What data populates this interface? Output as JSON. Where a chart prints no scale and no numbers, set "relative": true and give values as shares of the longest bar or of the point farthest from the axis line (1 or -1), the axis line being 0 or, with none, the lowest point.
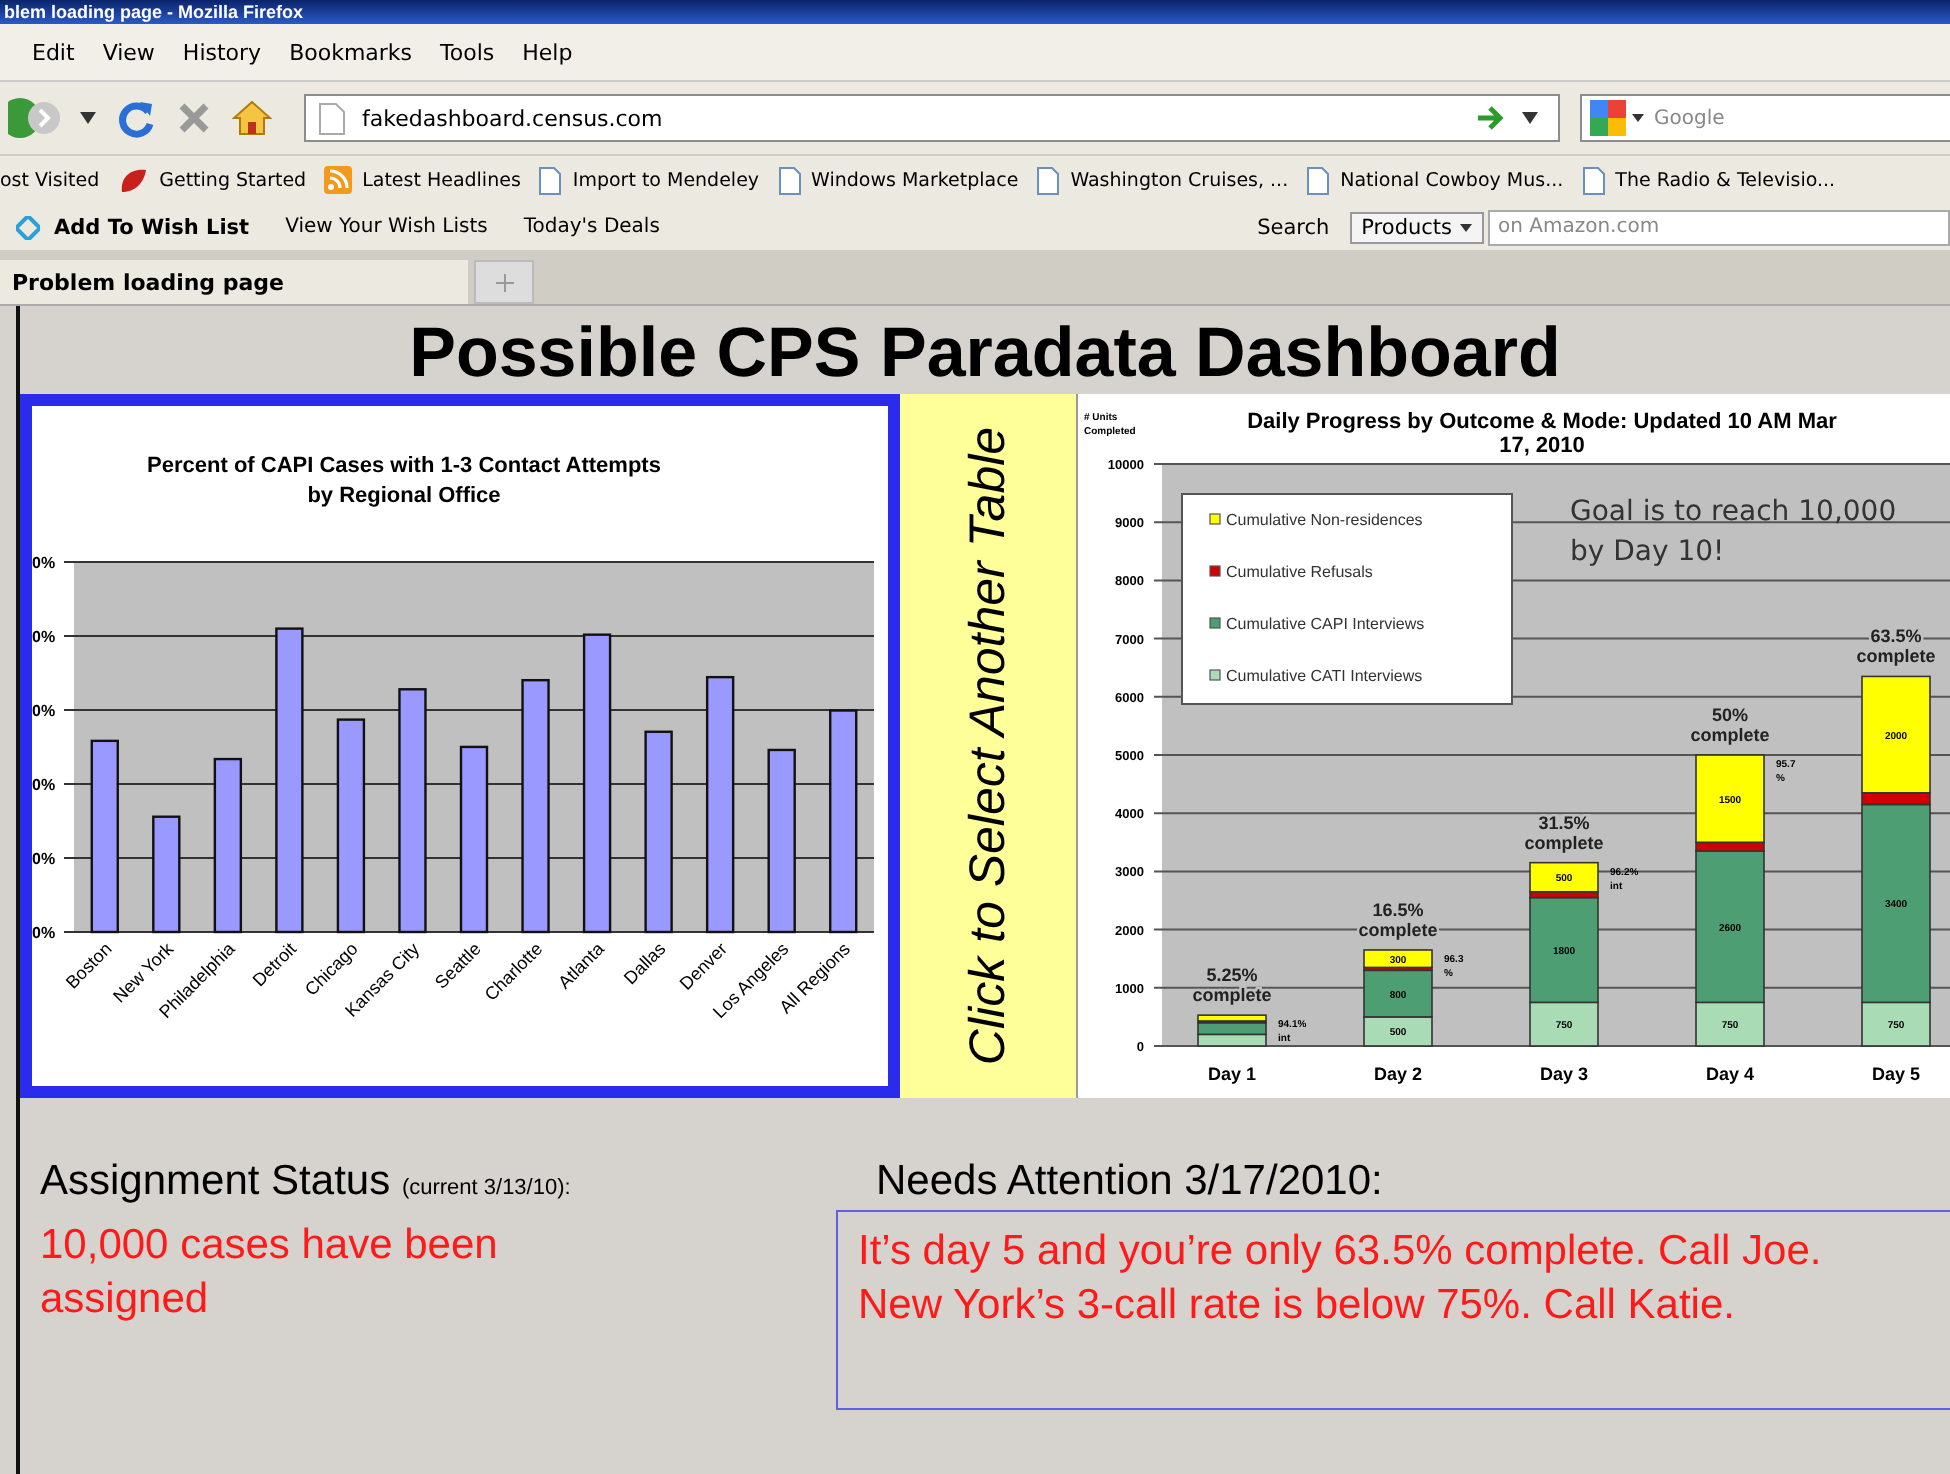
{
  "browser": {
    "title": "blem loading page - Mozilla Firefox",
    "menu": [
      "Edit",
      "View",
      "History",
      "Bookmarks",
      "Tools",
      "Help"
    ],
    "address": "fakedashboard.census.com",
    "search": {
      "placeholder": "Google"
    },
    "bookmarks": [
      {
        "label": "ost Visited",
        "kind": "plain"
      },
      {
        "label": "Getting Started",
        "kind": "starter"
      },
      {
        "label": "Latest Headlines",
        "kind": "feed"
      },
      {
        "label": "Import to Mendeley",
        "kind": "page"
      },
      {
        "label": "Windows Marketplace",
        "kind": "page"
      },
      {
        "label": "Washington Cruises, ...",
        "kind": "page"
      },
      {
        "label": "National Cowboy Mus...",
        "kind": "page"
      },
      {
        "label": "The Radio & Televisio...",
        "kind": "page"
      }
    ],
    "amazon_toolbar": {
      "wish_list": "Add To Wish List",
      "links": [
        "View Your Wish Lists",
        "Today's Deals"
      ],
      "search_label": "Search",
      "category": "Products",
      "placeholder": "on Amazon.com"
    },
    "tabs": [
      {
        "label": "Problem loading page",
        "selected": true
      }
    ]
  },
  "dashboard": {
    "title": "Possible CPS Paradata Dashboard",
    "left_chart": {
      "chart_data": {
        "type": "bar",
        "title": "Percent of CAPI Cases with 1-3 Contact Attempts\nby Regional Office",
        "categories": [
          "Boston",
          "New York",
          "Philadelphia",
          "Detroit",
          "Chicago",
          "Kansas City",
          "Seattle",
          "Charlotte",
          "Atlanta",
          "Dallas",
          "Denver",
          "Los Angeles",
          "All Regions"
        ],
        "values": [
          0.63,
          0.38,
          0.57,
          1,
          0.7,
          0.8,
          0.61,
          0.83,
          0.98,
          0.66,
          0.84,
          0.6,
          0.73
        ],
        "relative": true
      },
      "tick_labels": [
        "0%",
        "0%",
        "0%",
        "0%",
        "0%",
        "0%"
      ]
    },
    "select_table": "Click to Select Another Table",
    "right_chart": {
      "chart_data": {
        "type": "bar",
        "stacked": true,
        "title": "Daily Progress by Outcome & Mode: Updated 10 AM Mar\n17, 2010",
        "ylabel": "# Units\nCompleted",
        "categories": [
          "Day 1",
          "Day 2",
          "Day 3",
          "Day 4",
          "Day 5"
        ],
        "series": [
          {
            "name": "Cumulative CATI Interviews",
            "color": "#a9dcb4",
            "values": [
              200,
              500,
              750,
              750,
              750
            ],
            "value_labels": [
              null,
              "500",
              "750",
              "750",
              "750"
            ]
          },
          {
            "name": "Cumulative CAPI Interviews",
            "color": "#4e9e74",
            "values": [
              200,
              800,
              1800,
              2600,
              3400
            ],
            "value_labels": [
              null,
              "800",
              "1800",
              "2600",
              "3400"
            ]
          },
          {
            "name": "Cumulative Refusals",
            "color": "#d40000",
            "values": [
              30,
              50,
              100,
              150,
              200
            ],
            "value_labels": [
              null,
              null,
              null,
              null,
              null
            ]
          },
          {
            "name": "Cumulative Non-residences",
            "color": "#ffff00",
            "values": [
              100,
              300,
              500,
              1500,
              2000
            ],
            "value_labels": [
              null,
              "300",
              "500",
              "1500",
              "2000"
            ]
          }
        ],
        "ylim": [
          0,
          10000
        ],
        "yticks": [
          0,
          1000,
          2000,
          3000,
          4000,
          5000,
          6000,
          7000,
          8000,
          9000,
          10000
        ],
        "grid": true,
        "legend": "upper left"
      },
      "goal_note": [
        "Goal is to reach 10,000",
        "by Day 10!"
      ],
      "complete_labels": [
        [
          "5.25%",
          "complete"
        ],
        [
          "16.5%",
          "complete"
        ],
        [
          "31.5%",
          "complete"
        ],
        [
          "50%",
          "complete"
        ],
        [
          "63.5%",
          "complete"
        ]
      ],
      "rate_labels": [
        [
          "94.1%",
          "int"
        ],
        [
          "96.3",
          "%"
        ],
        [
          "96.2%",
          "int"
        ],
        [
          "95.7",
          "%"
        ]
      ]
    },
    "assignment": {
      "heading": "Assignment Status",
      "note": "(current 3/13/10):",
      "message": "10,000 cases have been assigned"
    },
    "attention": {
      "heading": "Needs Attention 3/17/2010:",
      "lines": [
        "It’s day 5 and you’re only 63.5% complete. Call Joe.",
        "New York’s 3-call rate is below 75%. Call Katie."
      ]
    }
  }
}
